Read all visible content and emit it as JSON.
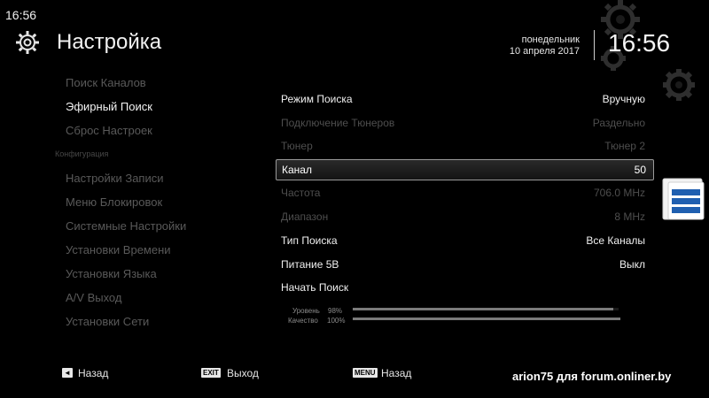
{
  "status": {
    "time_small": "16:56"
  },
  "header": {
    "title": "Настройка",
    "weekday": "понедельник",
    "date": "10 апреля 2017",
    "time_big": "16:56"
  },
  "menu": {
    "items": [
      {
        "label": "Поиск Каналов",
        "active": false
      },
      {
        "label": "Эфирный Поиск",
        "active": true
      },
      {
        "label": "Сброс Настроек",
        "active": false
      }
    ],
    "section": "Конфигурация",
    "config_items": [
      {
        "label": "Настройки Записи"
      },
      {
        "label": "Меню Блокировок"
      },
      {
        "label": "Системные Настройки"
      },
      {
        "label": "Установки Времени"
      },
      {
        "label": "Установки Языка"
      },
      {
        "label": "A/V Выход"
      },
      {
        "label": "Установки Сети"
      }
    ]
  },
  "settings": [
    {
      "label": "Режим Поиска",
      "value": "Вручную",
      "state": "enabled"
    },
    {
      "label": "Подключение Тюнеров",
      "value": "Раздельно",
      "state": "disabled"
    },
    {
      "label": "Тюнер",
      "value": "Тюнер 2",
      "state": "disabled"
    },
    {
      "label": "Канал",
      "value": "50",
      "state": "selected"
    },
    {
      "label": "Частота",
      "value": "706.0 MHz",
      "state": "disabled"
    },
    {
      "label": "Диапазон",
      "value": "8 MHz",
      "state": "disabled"
    },
    {
      "label": "Тип Поиска",
      "value": "Все Каналы",
      "state": "enabled"
    },
    {
      "label": "Питание 5В",
      "value": "Выкл",
      "state": "enabled"
    },
    {
      "label": "Начать Поиск",
      "value": "",
      "state": "enabled"
    }
  ],
  "signal": {
    "level_label": "Уровень",
    "level_value": "98%",
    "level_fraction": 0.98,
    "quality_label": "Качество",
    "quality_value": "100%",
    "quality_fraction": 1.0
  },
  "footer": {
    "back_key": "◄",
    "back_label": "Назад",
    "exit_key": "EXIT",
    "exit_label": "Выход",
    "menu_key": "MENU",
    "menu_label": "Назад"
  },
  "watermark": "arion75 для forum.onliner.by",
  "colors": {
    "background": "#000000",
    "text_active": "#f2f2f2",
    "text_inactive": "#595959",
    "selection_border": "#9a9a9a",
    "side_icon_blue": "#1f5fb0"
  }
}
